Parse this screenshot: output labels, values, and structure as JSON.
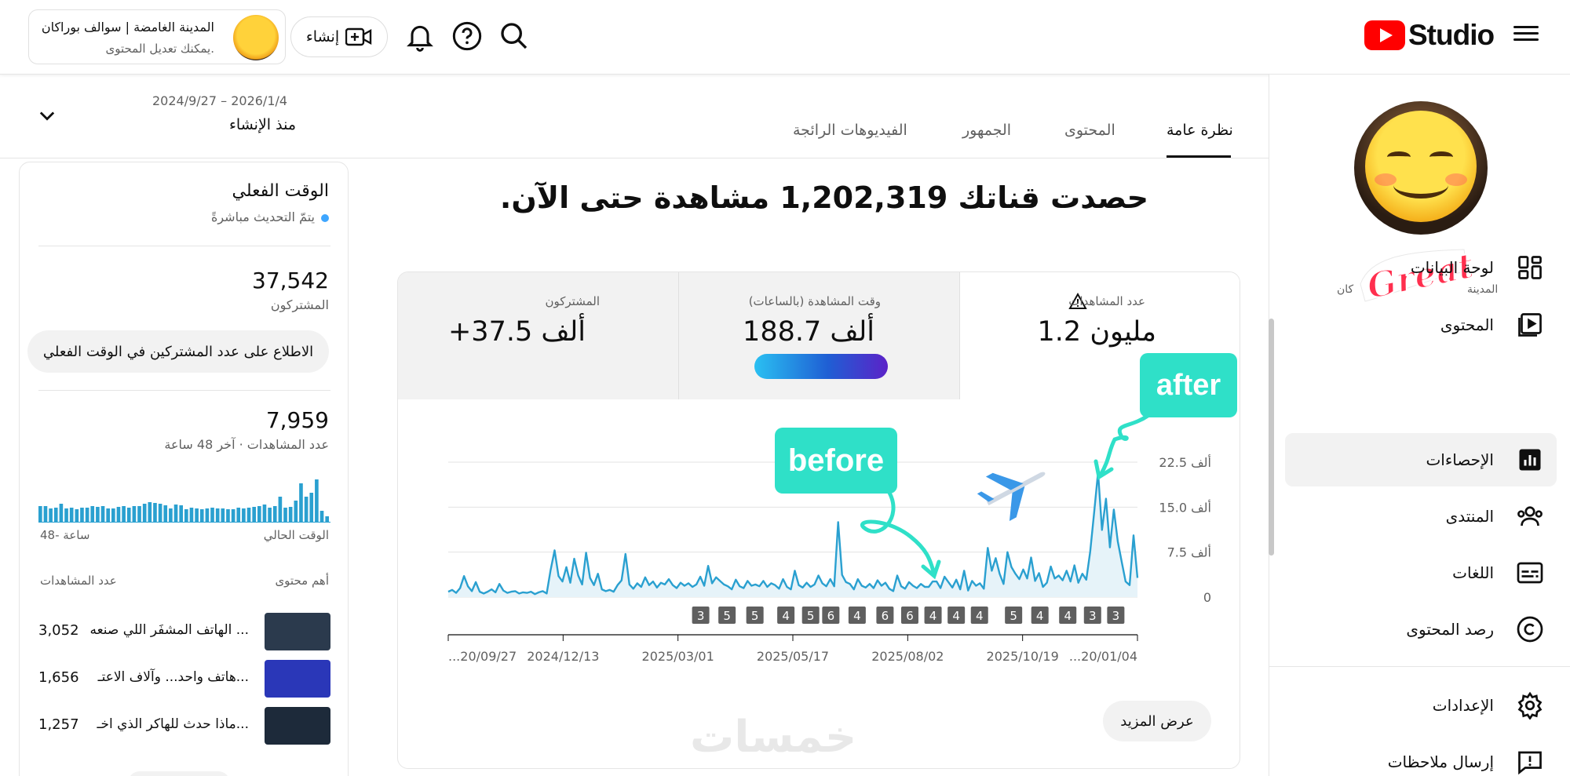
{
  "header": {
    "logo_text": "Studio",
    "create_label": "إنشاء",
    "account_name": "المدينة الغامضة | سوالف بوراكان",
    "account_sub": "يمكنك تعديل المحتوى."
  },
  "sidebar": {
    "channel_label_1": "المدينة",
    "channel_label_2": "كان",
    "items": [
      {
        "label": "لوحة البيانات",
        "icon": "dashboard-icon"
      },
      {
        "label": "المحتوى",
        "icon": "content-icon"
      },
      {
        "label": "الإحصاءات",
        "icon": "analytics-icon"
      },
      {
        "label": "المنتدى",
        "icon": "community-icon"
      },
      {
        "label": "اللغات",
        "icon": "subtitles-icon"
      },
      {
        "label": "رصد المحتوى",
        "icon": "copyright-icon"
      },
      {
        "label": "الإعدادات",
        "icon": "gear-icon"
      },
      {
        "label": "إرسال ملاحظات",
        "icon": "feedback-icon"
      }
    ]
  },
  "tabs": [
    {
      "label": "نظرة عامة"
    },
    {
      "label": "المحتوى"
    },
    {
      "label": "الجمهور"
    },
    {
      "label": "الفيديوهات الرائجة"
    }
  ],
  "date": {
    "range": "2024/9/27 – 2026/1/4",
    "preset": "منذ الإنشاء"
  },
  "headline": {
    "prefix": "حصدت قناتك ",
    "number": "1,202,319",
    "suffix": " مشاهدة حتى الآن."
  },
  "metrics": [
    {
      "label": "عدد المشاهدات",
      "value": "1.2 مليون"
    },
    {
      "label": "وقت المشاهدة (بالساعات)",
      "value": "188.7 ألف"
    },
    {
      "label": "المشتركون",
      "value": "+37.5 ألف"
    }
  ],
  "overlay": {
    "before": "before",
    "after": "after",
    "sticker": "Great!",
    "watermark": "خمسات"
  },
  "chart_data": {
    "type": "line",
    "x_tick_labels": [
      "...20/09/27",
      "2024/12/13",
      "2025/03/01",
      "2025/05/17",
      "2025/08/02",
      "2025/10/19",
      "...20/01/04"
    ],
    "y_tick_labels": [
      "0",
      "7.5 ألف",
      "15.0 ألف",
      "22.5 ألف"
    ],
    "ylim": [
      0,
      22500
    ],
    "series": [
      {
        "color": "#2aa0d0",
        "values": [
          900,
          1200,
          700,
          1500,
          3500,
          1800,
          1000,
          2500,
          900,
          600,
          900,
          1300,
          800,
          2200,
          1100,
          700,
          900,
          1000,
          600,
          800,
          700,
          900,
          500,
          800,
          1000,
          600,
          4500,
          7800,
          3500,
          2600,
          5000,
          2400,
          6400,
          3600,
          2100,
          7400,
          3200,
          2000,
          3900,
          1300,
          1000,
          1200,
          900,
          2000,
          2800,
          7200,
          2100,
          1400,
          2300,
          1700,
          3300,
          2000,
          2600,
          1600,
          2400,
          2100,
          3000,
          2000,
          1500,
          2400,
          1900,
          2300,
          1700,
          2100,
          3400,
          1900,
          5200,
          2300,
          3300,
          2700,
          2100,
          1800,
          1300,
          2900,
          1800,
          1500,
          2700,
          1900,
          2100,
          1800,
          2700,
          1700,
          2300,
          2000,
          1400,
          3000,
          1700,
          1300,
          4400,
          2000,
          1600,
          2400,
          1700,
          2100,
          3600,
          2300,
          1800,
          3000,
          1800,
          12500,
          3700,
          2500,
          2200,
          1300,
          3000,
          1900,
          1600,
          2200,
          1500,
          2800,
          1900,
          2400,
          1400,
          1000,
          3600,
          1800,
          1400,
          2500,
          1900,
          1500,
          2200,
          1700,
          1700,
          2600,
          2600,
          1500,
          3400,
          2500,
          1600,
          2900,
          1300,
          4400,
          1100,
          2700,
          1900,
          2300,
          1400,
          8200,
          4400,
          6500,
          3900,
          2200,
          7500,
          5000,
          3900,
          3000,
          4600,
          3100,
          6600,
          2700,
          4000,
          1700,
          2400,
          5100,
          3100,
          3600,
          2800,
          4400,
          2600,
          5300,
          2400,
          3900,
          2900,
          7600,
          14100,
          20800,
          11200,
          16400,
          8300,
          14600,
          9300,
          5900,
          2600,
          2000,
          10300,
          3200
        ]
      }
    ],
    "video_markers": [
      "3",
      "5",
      "5",
      "4",
      "5",
      "6",
      "4",
      "6",
      "6",
      "4",
      "4",
      "4",
      "5",
      "4",
      "4",
      "3",
      "3"
    ]
  },
  "show_more_label": "عرض المزيد",
  "realtime": {
    "title": "الوقت الفعلي",
    "live_text": "يتمّ التحديث مباشرةً",
    "subscribers": "37,542",
    "subscribers_label": "المشتركون",
    "subscribers_button": "الاطلاع على عدد المشتركين في الوقت الفعلي",
    "views": "7,959",
    "views_label": "عدد المشاهدات · آخر 48 ساعة",
    "axis_now": "الوقت الحالي",
    "axis_48": "48- ساعة",
    "top_content_label": "أهم محتوى",
    "views_column_label": "عدد المشاهدات",
    "bars": [
      20,
      20,
      17,
      18,
      23,
      17,
      18,
      16,
      18,
      18,
      20,
      19,
      20,
      17,
      17,
      19,
      20,
      18,
      20,
      20,
      23,
      25,
      24,
      23,
      21,
      17,
      22,
      21,
      16,
      18,
      17,
      16,
      17,
      18,
      17,
      17,
      16,
      16,
      18,
      17,
      18,
      19,
      20,
      22,
      18,
      20,
      32,
      18,
      19,
      27,
      49,
      32,
      37,
      54,
      14,
      7
    ],
    "top_videos": [
      {
        "title": "الهاتف المشفَر اللي صنعه ...",
        "views": "3,052",
        "thumb_color": "#2b3a4d"
      },
      {
        "title": "هاتف واحد... وآلاف الاعتـ...",
        "views": "1,656",
        "thumb_color": "#2a37b8"
      },
      {
        "title": "ماذا حدث للهاكر الذي اخـ...",
        "views": "1,257",
        "thumb_color": "#1d2a3a"
      }
    ]
  }
}
